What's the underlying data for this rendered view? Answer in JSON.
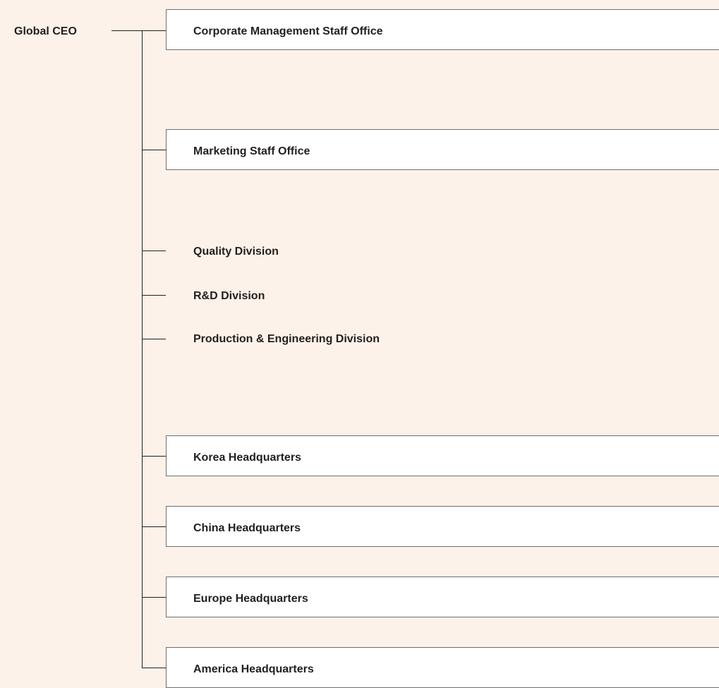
{
  "root": {
    "label": "Global CEO"
  },
  "nodes": [
    {
      "id": "corporate-management",
      "label": "Corporate Management Staff Office",
      "boxed": true
    },
    {
      "id": "marketing",
      "label": "Marketing Staff Office",
      "boxed": true
    },
    {
      "id": "quality",
      "label": "Quality Division",
      "boxed": false
    },
    {
      "id": "rnd",
      "label": "R&D Division",
      "boxed": false
    },
    {
      "id": "production-engineering",
      "label": "Production & Engineering Division",
      "boxed": false
    },
    {
      "id": "korea-hq",
      "label": "Korea Headquarters",
      "boxed": true
    },
    {
      "id": "china-hq",
      "label": "China Headquarters",
      "boxed": true
    },
    {
      "id": "europe-hq",
      "label": "Europe Headquarters",
      "boxed": true
    },
    {
      "id": "america-hq",
      "label": "America Headquarters",
      "boxed": true
    }
  ]
}
